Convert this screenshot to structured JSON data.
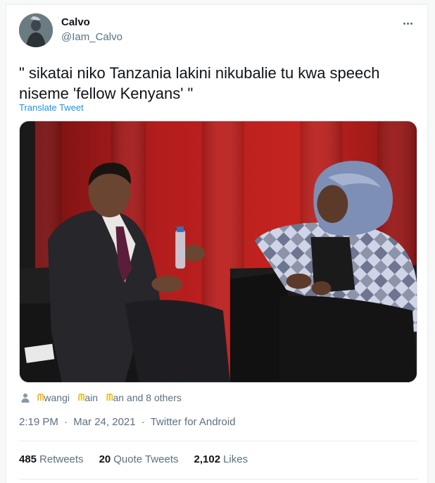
{
  "user": {
    "name": "Calvo",
    "handle": "@Iam_Calvo"
  },
  "icons": {
    "more": "more-horizontal-icon",
    "likers": "person-icon"
  },
  "tweet": {
    "text": "\" sikatai niko Tanzania lakini nikubalie tu kwa speech niseme 'fellow Kenyans' \"",
    "translate_label": "Translate Tweet"
  },
  "likers": {
    "names": [
      "wangi",
      "ain",
      "an"
    ],
    "mark": "ᗰ",
    "suffix": "and 8 others"
  },
  "meta": {
    "time": "2:19 PM",
    "separator": "·",
    "date": "Mar 24, 2021",
    "source": "Twitter for Android"
  },
  "stats": {
    "retweets_count": "485",
    "retweets_label": "Retweets",
    "quotes_count": "20",
    "quotes_label": "Quote Tweets",
    "likes_count": "2,102",
    "likes_label": "Likes"
  },
  "colors": {
    "link": "#1b95e0",
    "secondary_text": "#5b7083",
    "background_red": "#b01c1c"
  }
}
